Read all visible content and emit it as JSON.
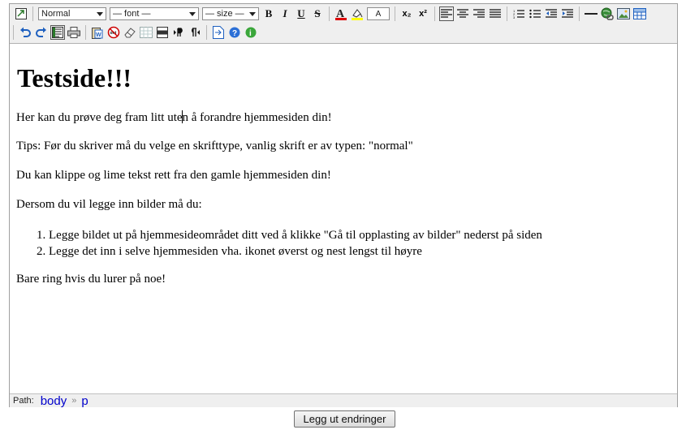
{
  "toolbar": {
    "format_select": "Normal",
    "font_select": "— font —",
    "size_select": "— size —",
    "bold": "B",
    "italic": "I",
    "underline": "U",
    "strike": "S",
    "subscript": "x₂",
    "superscript": "x²",
    "textbox_label": "A"
  },
  "content": {
    "heading": "Testside!!!",
    "p1_before": "Her kan du prøve deg fram litt ute",
    "p1_after": "n å forandre hjemmesiden din!",
    "p2": "Tips: Før du skriver må du velge en skrifttype, vanlig skrift er av typen: \"normal\"",
    "p3": "Du kan klippe og lime tekst rett fra den gamle hjemmesiden din!",
    "p4": "Dersom du vil legge inn bilder må du:",
    "list": [
      "Legge bildet ut på hjemmesideområdet ditt ved å klikke \"Gå til opplasting av bilder\" nederst på siden",
      "Legge det inn i selve hjemmesiden vha. ikonet øverst og nest lengst til høyre"
    ],
    "p5": "Bare ring hvis du lurer på noe!"
  },
  "statusbar": {
    "path_label": "Path:",
    "path_items": [
      "body",
      "p"
    ],
    "separator": "»"
  },
  "submit_label": "Legg ut endringer",
  "colors": {
    "toolbar_bg": "#efefef",
    "link_blue": "#0000cc",
    "button_icon_blue": "#1d5fbf"
  }
}
